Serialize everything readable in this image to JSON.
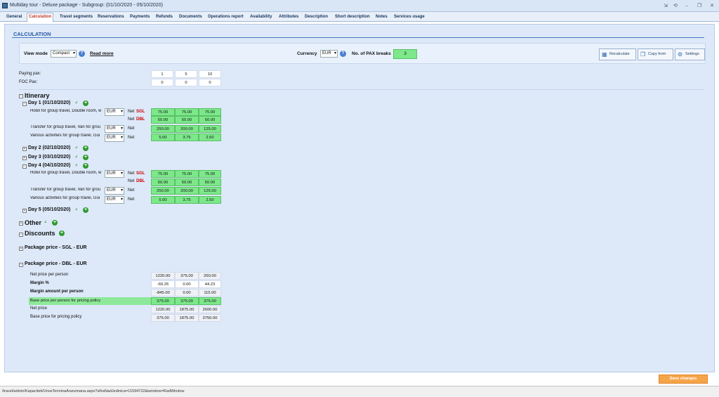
{
  "window": {
    "title": "Multiday tour - Deluxe package - Subgroup: (01/10/2020 - 05/10/2020)"
  },
  "tabs": [
    "General",
    "Calculation",
    "Travel segments",
    "Reservations",
    "Payments",
    "Refunds",
    "Documents",
    "Operations report",
    "Availability",
    "Attributes",
    "Description",
    "Short description",
    "Notes",
    "Services usage"
  ],
  "active_tab": "Calculation",
  "section_title": "CALCULATION",
  "toolbar": {
    "view_mode_label": "View mode",
    "view_mode_value": "Compact",
    "read_more": "Read more",
    "currency_label": "Currency",
    "currency_value": "EUR",
    "pax_breaks_label": "No. of PAX breaks",
    "pax_breaks_value": "3",
    "recalculate": "Recalculate",
    "copy_from": "Copy from",
    "settings": "Settings"
  },
  "pax": {
    "paying_label": "Paying pax:",
    "foc_label": "FOC Pax:",
    "paying": [
      "1",
      "5",
      "10"
    ],
    "foc": [
      "0",
      "0",
      "0"
    ]
  },
  "itinerary": {
    "title": "Itinerary",
    "day1": {
      "label": "Day 1 (01/10/2020)"
    },
    "day2": {
      "label": "Day 2 (02/10/2020)"
    },
    "day3": {
      "label": "Day 3 (03/10/2020)"
    },
    "day4": {
      "label": "Day 4 (04/10/2020)"
    },
    "day5": {
      "label": "Day 5 (05/10/2020)"
    },
    "hotel": "Hotel for group travel, Double room, w",
    "transfer": "Transfer for group travel, Van for grou",
    "activities": "Various activities for group travel, Gui",
    "eur": "EUR",
    "net": "Net",
    "sgl": "SGL",
    "dbl": "DBL",
    "sgl_values": [
      "75.00",
      "75.00",
      "75.00"
    ],
    "dbl_values": [
      "50.00",
      "50.00",
      "50.00"
    ],
    "transfer_values": [
      "250.00",
      "200.00",
      "125.00"
    ],
    "activities_values": [
      "5.00",
      "3.75",
      "2.50"
    ]
  },
  "other": "Other",
  "discounts": "Discounts",
  "package_sgl": "Package price - SGL - EUR",
  "package_dbl": "Package price - DBL - EUR",
  "summary": {
    "net_pp_label": "Net price per person",
    "net_pp": [
      "1220.00",
      "375.00",
      "260.00"
    ],
    "margin_pct_label": "Margin %",
    "margin_pct": [
      "-69.26",
      "0.00",
      "44.23"
    ],
    "margin_amt_label": "Margin amount per person",
    "margin_amt": [
      "-845.00",
      "0.00",
      "115.00"
    ],
    "base_pp_label": "Base price per person for pricing policy",
    "base_pp": [
      "375.00",
      "375.00",
      "375.00"
    ],
    "net_label": "Net price",
    "net": [
      "1220.00",
      "1875.00",
      "2600.00"
    ],
    "base_label": "Base price for pricing policy",
    "base": [
      "375.00",
      "1875.00",
      "3750.00"
    ]
  },
  "save_changes": "Save changes",
  "status_url": "/travel/admin/Kapaciteti/UnosTerminaAranzmana.aspx?sifraNadJedinica=11594722&iwindow=RadWindow"
}
